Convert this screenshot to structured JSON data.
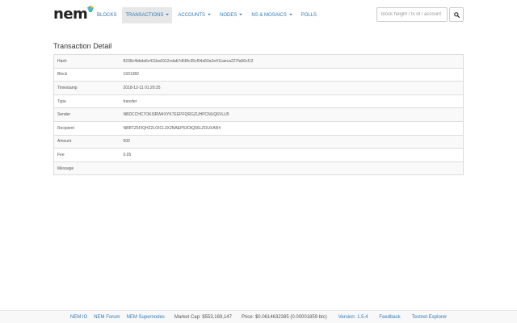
{
  "brand": {
    "name": "nem",
    "accent": "#2bbfbd"
  },
  "nav": {
    "items": [
      {
        "label": "BLOCKS",
        "dropdown": false,
        "active": false
      },
      {
        "label": "TRANSACTIONS",
        "dropdown": true,
        "active": true
      },
      {
        "label": "ACCOUNTS",
        "dropdown": true,
        "active": false
      },
      {
        "label": "NODES",
        "dropdown": true,
        "active": false
      },
      {
        "label": "NS & MOSAICS",
        "dropdown": true,
        "active": false
      },
      {
        "label": "POLLS",
        "dropdown": false,
        "active": false
      }
    ]
  },
  "search": {
    "placeholder": "block height / tx id / account",
    "icon": "search-icon"
  },
  "page": {
    "title": "Transaction Detail"
  },
  "transaction": {
    "rows": [
      {
        "key": "Hash",
        "value": "8238c4bbda6c411ba0112cdab7d66fc35cf04a50a2e411aeca227fa56cf12"
      },
      {
        "key": "Block",
        "value": "1931382"
      },
      {
        "key": "Timestamp",
        "value": "2018-12-11 01:26:25"
      },
      {
        "key": "Type",
        "value": "transfer"
      },
      {
        "key": "Sender",
        "value": "NBDCCHC7OKI3RW4XYK7EEPFQRGZUHPCNUQ6VLU5"
      },
      {
        "key": "Recipient",
        "value": "NBBTZ5FIQHZ2LOICL3X2NAEP53OIQ56LZOUXAR4"
      },
      {
        "key": "Amount",
        "value": "500"
      },
      {
        "key": "Fee",
        "value": "0.05"
      },
      {
        "key": "Message",
        "value": ""
      }
    ]
  },
  "footer": {
    "links": [
      "NEM IO",
      "NEM Forum",
      "NEM Supernodes"
    ],
    "market_cap": "Market Cap: $553,169,147",
    "price": "Price: $0.0614632385 (0.00001859 btc)",
    "version": "Version: 1.5.4",
    "feedback": "Feedback",
    "testnet": "Testnet Explorer"
  }
}
